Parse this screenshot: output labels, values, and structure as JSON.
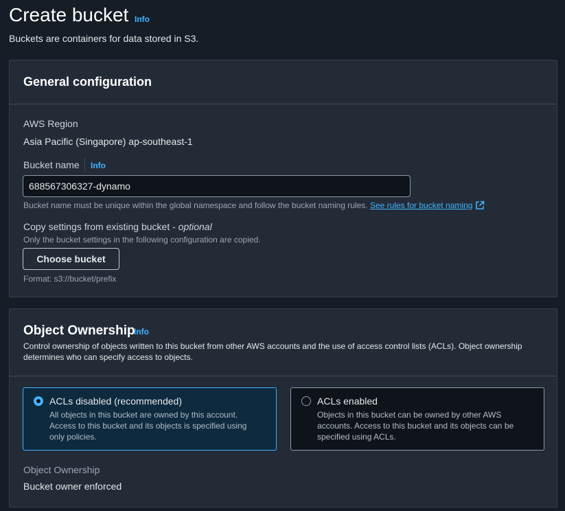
{
  "header": {
    "title": "Create bucket",
    "info": "Info",
    "description": "Buckets are containers for data stored in S3."
  },
  "general": {
    "title": "General configuration",
    "region_label": "AWS Region",
    "region_value": "Asia Pacific (Singapore) ap-southeast-1",
    "bucket_name_label": "Bucket name",
    "bucket_name_info": "Info",
    "bucket_name_value": "688567306327-dynamo",
    "bucket_name_hint": "Bucket name must be unique within the global namespace and follow the bucket naming rules.",
    "rules_link": "See rules for bucket naming",
    "copy_label": "Copy settings from existing bucket -",
    "copy_optional": "optional",
    "copy_desc": "Only the bucket settings in the following configuration are copied.",
    "choose_button": "Choose bucket",
    "format_hint": "Format: s3://bucket/prefix"
  },
  "ownership": {
    "title": "Object Ownership",
    "info": "Info",
    "description_line1": "Control ownership of objects written to this bucket from other AWS accounts and the use of access control lists (ACLs). Object ownership",
    "description_line2": "determines who can specify access to objects.",
    "option_disabled": {
      "title": "ACLs disabled (recommended)",
      "desc_line1": "All objects in this bucket are owned by this account.",
      "desc_line2": "Access to this bucket and its objects is specified using",
      "desc_line3": "only policies.",
      "selected": true
    },
    "option_enabled": {
      "title": "ACLs enabled",
      "desc_line1": "Objects in this bucket can be owned by other AWS",
      "desc_line2": "accounts. Access to this bucket and its objects can be",
      "desc_line3": "specified using ACLs.",
      "selected": false
    },
    "result_label": "Object Ownership",
    "result_value": "Bucket owner enforced"
  },
  "colors": {
    "background": "#161d26",
    "panel": "#232b37",
    "accent": "#42b4ff"
  }
}
